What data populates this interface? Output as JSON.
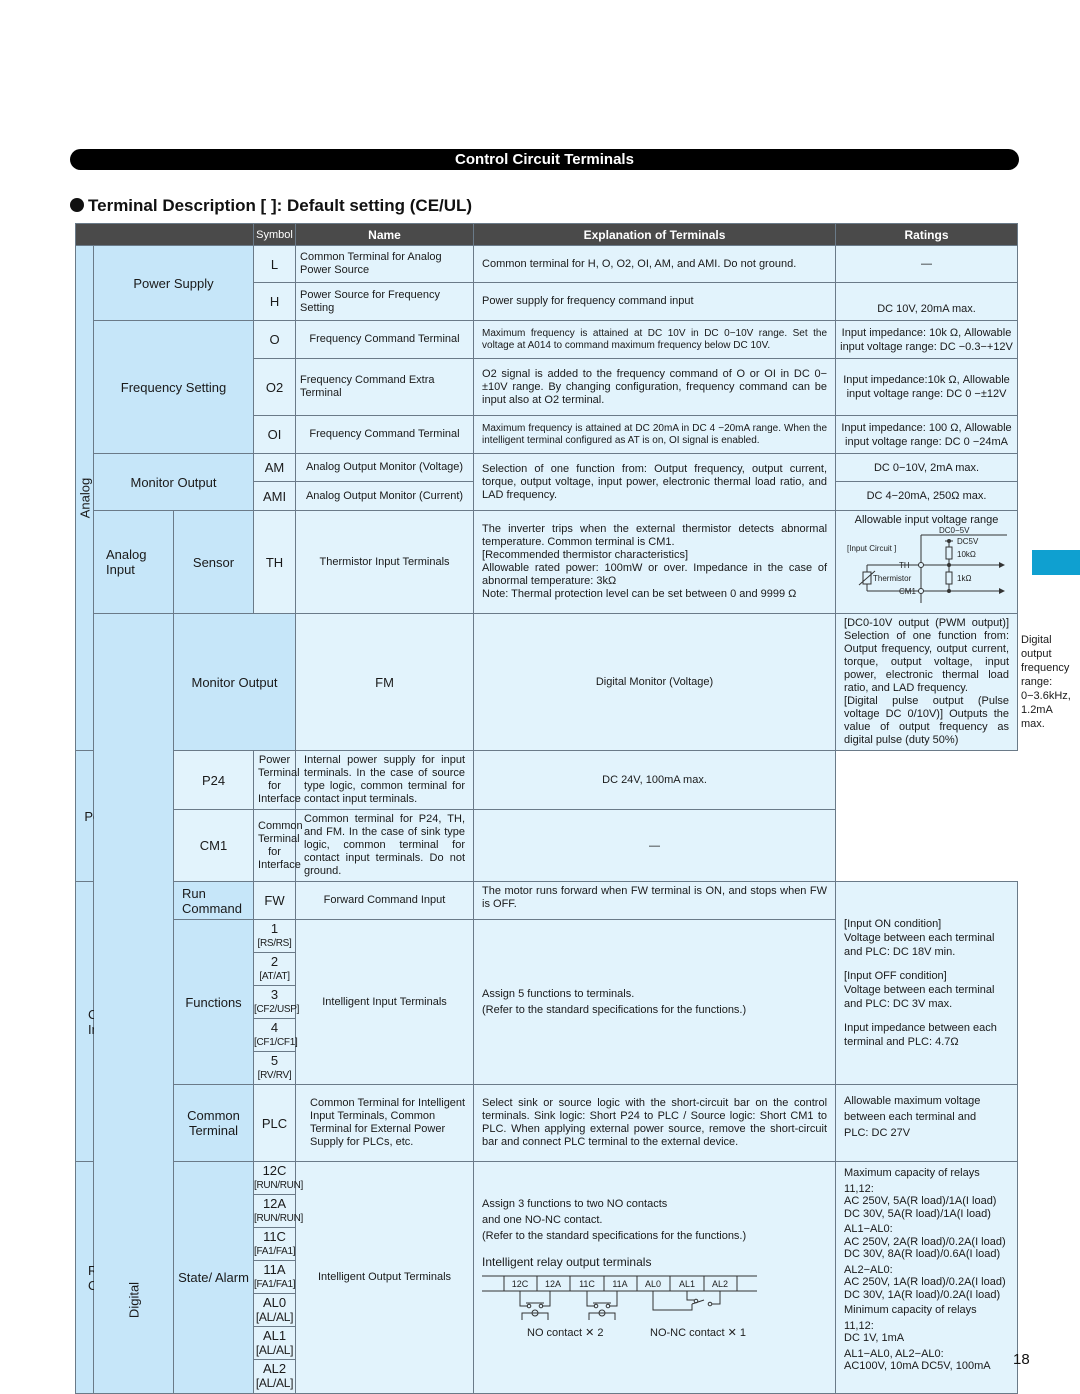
{
  "banner": "Control Circuit Terminals",
  "section_title": "Terminal Description  [    ]: Default setting (CE/UL)",
  "page_number": "18",
  "header": {
    "symbol": "Symbol",
    "name": "Name",
    "explanation": "Explanation of Terminals",
    "ratings": "Ratings"
  },
  "groups": {
    "analog": "Analog",
    "digital": "Digital"
  },
  "analog": {
    "power_supply": {
      "category": "Power Supply",
      "rows": [
        {
          "symbol": "L",
          "name": "Common Terminal for Analog Power Source",
          "explanation": "Common terminal for H, O, O2, OI, AM, and AMI. Do not ground.",
          "rating": "—"
        },
        {
          "symbol": "H",
          "name": "Power Source for Frequency Setting",
          "explanation": "Power supply for frequency command input",
          "rating": "DC 10V, 20mA max."
        }
      ]
    },
    "frequency_setting": {
      "category": "Frequency Setting",
      "rows": [
        {
          "symbol": "O",
          "name": "Frequency Command Terminal",
          "explanation": "Maximum frequency is attained at DC 10V in DC 0−10V range. Set the voltage at A014 to command maximum frequency below  DC 10V.",
          "rating": "Input impedance: 10k Ω, Allowable input voltage range: DC  −0.3−+12V"
        },
        {
          "symbol": "O2",
          "name": "Frequency Command Extra Terminal",
          "explanation": "O2 signal is added to the frequency command of O or OI in DC 0−±10V range. By changing configuration, frequency command can be input also at O2 terminal.",
          "rating": "Input impedance:10k Ω, Allowable input voltage range: DC 0 −±12V"
        },
        {
          "symbol": "OI",
          "name": "Frequency Command Terminal",
          "explanation": "Maximum frequency is attained at DC 20mA in DC 4 −20mA range. When the intelligent terminal configured as AT is on, OI signal is enabled.",
          "rating": "Input impedance: 100 Ω, Allowable input voltage range: DC 0 −24mA"
        }
      ]
    },
    "monitor_output": {
      "category": "Monitor Output",
      "explanation": "Selection of one function from: Output frequency, output current, torque, output voltage, input power, electronic thermal load ratio, and LAD frequency.",
      "rows": [
        {
          "symbol": "AM",
          "name": "Analog Output Monitor (Voltage)",
          "rating": "DC 0−10V, 2mA max."
        },
        {
          "symbol": "AMI",
          "name": "Analog Output Monitor (Current)",
          "rating": "DC 4−20mA, 250Ω max."
        }
      ]
    },
    "analog_input": {
      "category": "Analog Input",
      "subcategory": "Sensor",
      "symbol": "TH",
      "name": "Thermistor Input Terminals",
      "explanation": [
        "The inverter trips when the external thermistor detects abnormal temperature. Common terminal is CM1.",
        "[Recommended thermistor characteristics]",
        "Allowable rated power: 100mW or over. Impedance in the case of abnormal temperature: 3kΩ",
        "Note: Thermal protection level can be set between 0 and 9999 Ω"
      ],
      "rating_title": "Allowable input voltage range",
      "circuit": {
        "range": "DC0−5V",
        "supply": "DC5V",
        "r1": "10kΩ",
        "r2": "1kΩ",
        "input_circuit": "[Input Circuit ]",
        "th": "TH",
        "thermistor": "Thermistor",
        "cm1": "CM1"
      }
    }
  },
  "digital": {
    "monitor_output": {
      "category": "Monitor Output",
      "symbol": "FM",
      "name": "Digital Monitor (Voltage)",
      "explanation": [
        "[DC0-10V output (PWM output)]  Selection of one function from: Output frequency, output current, torque, output voltage, input power, electronic thermal load ratio, and LAD frequency.",
        "[Digital pulse output (Pulse voltage DC 0/10V)] Outputs the value of output frequency as digital pulse (duty 50%)"
      ],
      "rating": "Digital output frequency range: 0−3.6kHz, 1.2mA max."
    },
    "power_supply": {
      "category": "Power Supply",
      "rows": [
        {
          "symbol": "P24",
          "name": "Power Terminal for Interface",
          "explanation": "Internal power supply for input terminals. In the case of source type logic, common terminal for contact input terminals.",
          "rating": "DC 24V, 100mA max."
        },
        {
          "symbol": "CM1",
          "name": "Common Terminal for Interface",
          "explanation": "Common terminal for P24, TH, and FM. In the case of sink type logic, common terminal for contact input terminals. Do not ground.",
          "rating": "—"
        }
      ]
    },
    "contact_input": {
      "category": "Contact Input",
      "run_command": {
        "subcategory": "Run Command",
        "symbol": "FW",
        "name": "Forward Command Input",
        "explanation": "The motor runs forward when FW terminal is ON, and stops when FW is OFF."
      },
      "functions": {
        "subcategory": "Functions",
        "symbols": [
          {
            "num": "1",
            "default": "[RS/RS]"
          },
          {
            "num": "2",
            "default": "[AT/AT]"
          },
          {
            "num": "3",
            "default": "[CF2/USP]"
          },
          {
            "num": "4",
            "default": "[CF1/CF1]"
          },
          {
            "num": "5",
            "default": "[RV/RV]"
          }
        ],
        "name": "Intelligent Input Terminals",
        "explanation": [
          "Assign 5 functions to terminals.",
          "(Refer to the standard specifications for the functions.)"
        ]
      },
      "rating": [
        "[Input ON condition]",
        "Voltage between each terminal",
        "and PLC: DC 18V min.",
        "[Input OFF condition]",
        "Voltage between each terminal",
        "and PLC: DC 3V max.",
        "Input impedance between each",
        "terminal and PLC: 4.7Ω"
      ],
      "common_terminal": {
        "subcategory": "Common Terminal",
        "symbol": "PLC",
        "name": "Common Terminal for Intelligent Input Terminals, Common Terminal for External Power Supply for PLCs, etc.",
        "explanation": "Select sink or source logic with the short-circuit bar on the control terminals. Sink logic: Short P24 to PLC / Source logic: Short CM1 to PLC. When applying external power source, remove the short-circuit bar and connect PLC terminal to the external device.",
        "rating": [
          "Allowable maximum voltage",
          "between each terminal and",
          "PLC: DC 27V"
        ]
      }
    },
    "relay_output": {
      "category": "Relay Output",
      "subcategory": "State/ Alarm",
      "symbols": [
        {
          "num": "12C",
          "default": "[RUN/RUN]"
        },
        {
          "num": "12A",
          "default": "[RUN/RUN]"
        },
        {
          "num": "11C",
          "default": "[FA1/FA1]"
        },
        {
          "num": "11A",
          "default": "[FA1/FA1]"
        },
        {
          "num": "AL0",
          "default": "[AL/AL]"
        },
        {
          "num": "AL1",
          "default": "[AL/AL]"
        },
        {
          "num": "AL2",
          "default": "[AL/AL]"
        }
      ],
      "name": "Intelligent Output Terminals",
      "explanation": [
        "Assign 3 functions to two NO contacts",
        "and one NO-NC contact.",
        "(Refer to the standard specifications for the functions.)"
      ],
      "diagram_title": "Intelligent relay output terminals",
      "diagram_terminals": [
        "12C",
        "12A",
        "11C",
        "11A",
        "AL0",
        "AL1",
        "AL2"
      ],
      "no_contact_label": "NO contact ✕ 2",
      "nonc_contact_label": "NO-NC contact ✕ 1",
      "rating": [
        "Maximum capacity of relays",
        "11,12:",
        "AC 250V, 5A(R load)/1A(I load)",
        "DC 30V, 5A(R load)/1A(I load)",
        "AL1−AL0:",
        "AC 250V, 2A(R load)/0.2A(I load)",
        "DC 30V, 8A(R load)/0.6A(I load)",
        "AL2−AL0:",
        "AC 250V, 1A(R load)/0.2A(I load)",
        "DC 30V, 1A(R load)/0.2A(I load)",
        "Minimum capacity of relays",
        "11,12:",
        "DC 1V, 1mA",
        "AL1−AL0, AL2−AL0:",
        "AC100V, 10mA DC5V, 100mA"
      ]
    }
  }
}
